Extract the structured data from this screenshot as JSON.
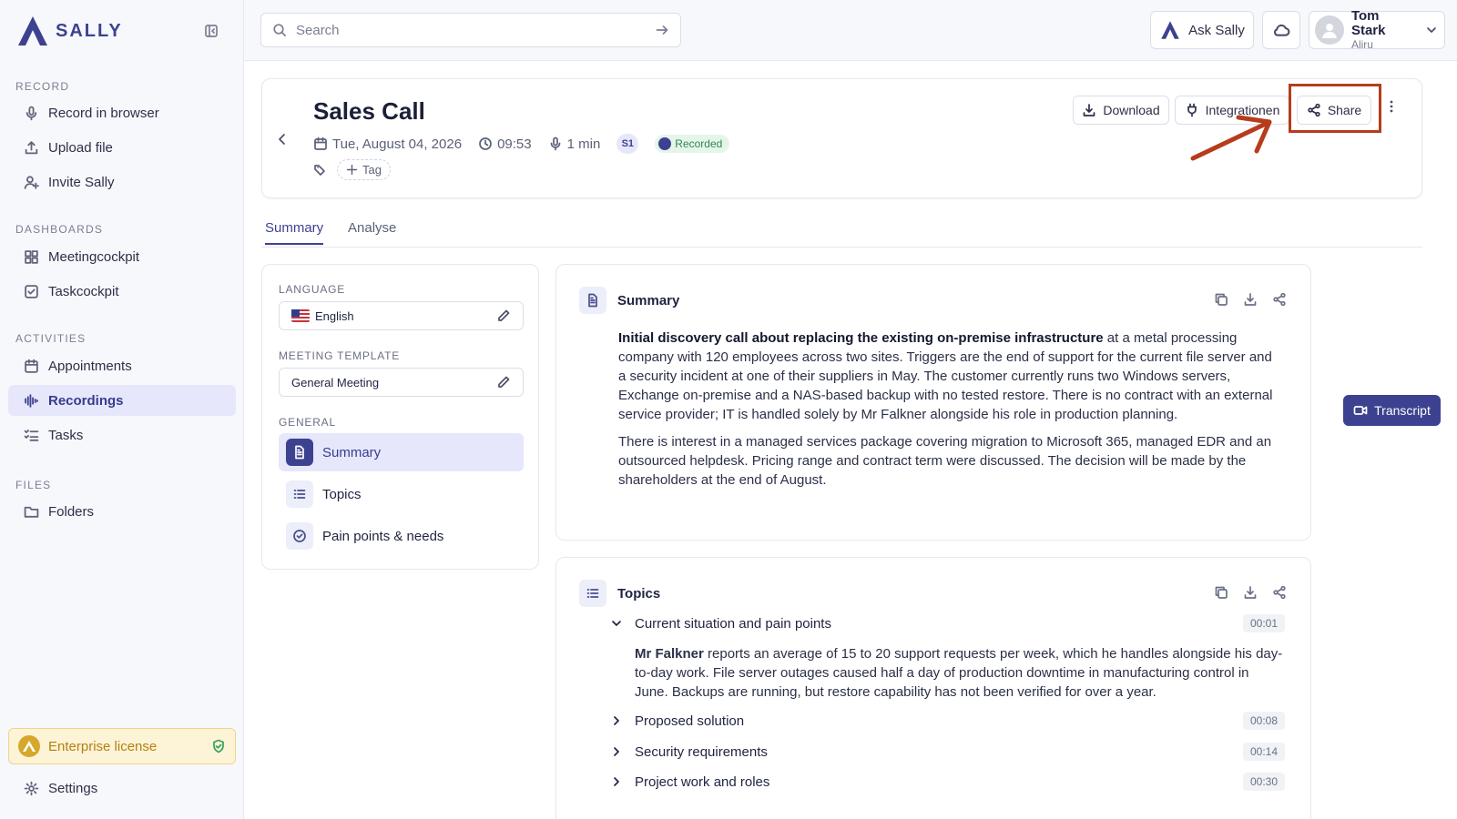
{
  "app": {
    "brand": "SALLY"
  },
  "sidebar": {
    "sections": [
      {
        "label": "RECORD"
      },
      {
        "label": "DASHBOARDS"
      },
      {
        "label": "ACTIVITIES"
      },
      {
        "label": "FILES"
      }
    ],
    "items": [
      {
        "label": "Record in browser",
        "icon": "mic-icon"
      },
      {
        "label": "Upload file",
        "icon": "upload-icon"
      },
      {
        "label": "Invite Sally",
        "icon": "user-plus-icon"
      },
      {
        "label": "Meetingcockpit",
        "icon": "grid-icon"
      },
      {
        "label": "Taskcockpit",
        "icon": "checkbox-icon"
      },
      {
        "label": "Appointments",
        "icon": "calendar-icon"
      },
      {
        "label": "Recordings",
        "icon": "waveform-icon",
        "active": true
      },
      {
        "label": "Tasks",
        "icon": "list-check-icon"
      },
      {
        "label": "Folders",
        "icon": "folder-icon"
      }
    ],
    "license": "Enterprise license",
    "settings": "Settings"
  },
  "topbar": {
    "search_placeholder": "Search",
    "ask": "Ask Sally",
    "user": {
      "name": "Tom Stark",
      "org": "Aliru"
    }
  },
  "recording": {
    "title": "Sales Call",
    "date": "Tue, August 04, 2026",
    "time": "09:53",
    "duration": "1 min",
    "speaker_badge": "S1",
    "status": "Recorded",
    "tag_button": "Tag",
    "actions": {
      "download": "Download",
      "integrations": "Integrationen",
      "share": "Share"
    }
  },
  "tabs": [
    {
      "label": "Summary",
      "active": true
    },
    {
      "label": "Analyse"
    }
  ],
  "settings_panel": {
    "language_label": "LANGUAGE",
    "language_value": "English",
    "template_label": "MEETING TEMPLATE",
    "template_value": "General Meeting",
    "general_label": "GENERAL",
    "items": [
      {
        "label": "Summary",
        "active": true
      },
      {
        "label": "Topics"
      },
      {
        "label": "Pain points & needs"
      }
    ]
  },
  "summary_card": {
    "title": "Summary",
    "p1_bold": "Initial discovery call about replacing the existing on-premise infrastructure",
    "p1_rest": " at a metal processing company with 120 employees across two sites. Triggers are the end of support for the current file server and a security incident at one of their suppliers in May. The customer currently runs two Windows servers, Exchange on-premise and a NAS-based backup with no tested restore. There is no contract with an external service provider; IT is handled solely by Mr Falkner alongside his role in production planning.",
    "p2": "There is interest in a managed services package covering migration to Microsoft 365, managed EDR and an outsourced helpdesk. Pricing range and contract term were discussed. The decision will be made by the shareholders at the end of August."
  },
  "topics_card": {
    "title": "Topics",
    "topics": [
      {
        "title": "Current situation and pain points",
        "time": "00:01",
        "expanded": true
      },
      {
        "title": "Proposed solution",
        "time": "00:08"
      },
      {
        "title": "Security requirements",
        "time": "00:14"
      },
      {
        "title": "Project work and roles",
        "time": "00:30"
      }
    ],
    "expanded_bold": "Mr Falkner",
    "expanded_rest": " reports an average of 15 to 20 support requests per week, which he handles alongside his day-to-day work. File server outages caused half a day of production downtime in manufacturing control in June. Backups are running, but restore capability has not been verified for over a year."
  },
  "transcript_button": "Transcript",
  "colors": {
    "accent": "#3d4290",
    "highlight": "#b63c1c",
    "success": "#2e8b4e",
    "license": "#d6a72a"
  }
}
